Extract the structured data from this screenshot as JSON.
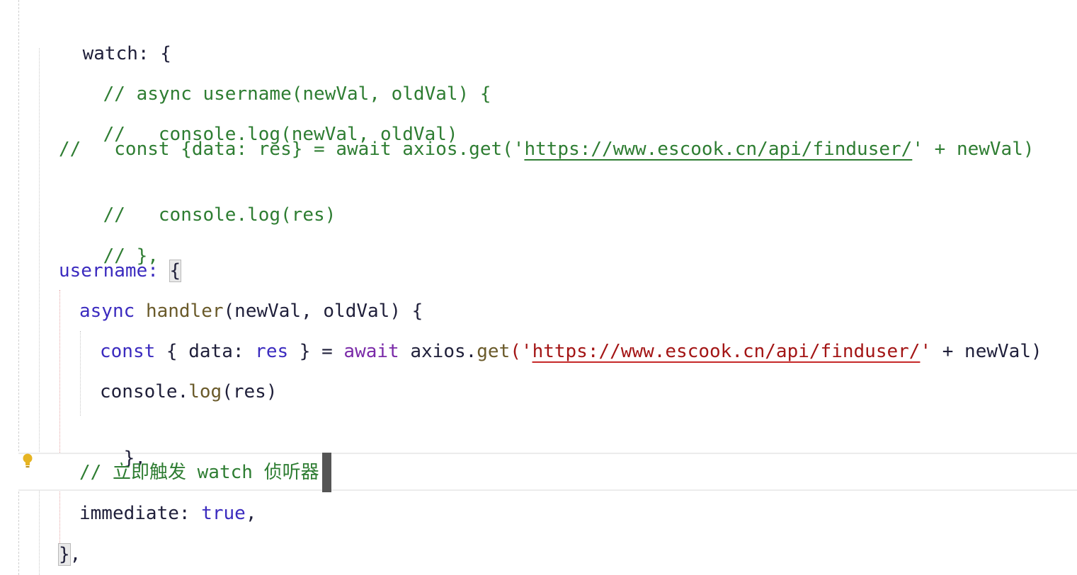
{
  "editor": {
    "lines": [
      {
        "id": "l1",
        "tokens": [
          "watch: {"
        ]
      },
      {
        "id": "l2",
        "tokens": [
          "// async username(newVal, oldVal) {"
        ]
      },
      {
        "id": "l3",
        "tokens": [
          "//   console.log(newVal, oldVal)"
        ]
      },
      {
        "id": "l4",
        "tokens": [
          "//   const {data: res} = await axios.get('",
          "https://www.escook.cn/api/finduser/",
          "' + newVal)"
        ]
      },
      {
        "id": "l5",
        "tokens": [
          "//   console.log(res)"
        ]
      },
      {
        "id": "l6",
        "tokens": [
          "// },"
        ]
      },
      {
        "id": "l7",
        "tokens": [
          "username: ",
          "{"
        ]
      },
      {
        "id": "l8",
        "tokens": [
          "async",
          " ",
          "handler",
          "(newVal, oldVal) {"
        ]
      },
      {
        "id": "l9",
        "tokens": [
          "const",
          " { data: ",
          "res",
          " } = ",
          "await",
          " axios.",
          "get",
          "('",
          "https://www.escook.cn/api/finduser/",
          "'",
          " + newVal)"
        ]
      },
      {
        "id": "l10",
        "tokens": [
          "console.",
          "log",
          "(res)"
        ]
      },
      {
        "id": "l11",
        "tokens": [
          "},"
        ]
      },
      {
        "id": "l12",
        "tokens": [
          "// ",
          "立即触发",
          " watch ",
          "侦听器"
        ]
      },
      {
        "id": "l13",
        "tokens": [
          "immediate: ",
          "true",
          ","
        ]
      },
      {
        "id": "l14",
        "tokens": [
          "}",
          ","
        ]
      }
    ]
  },
  "icons": {
    "gutter": "lightbulb-icon"
  },
  "colors": {
    "comment": "#2e7d32",
    "keyword": "#3b2bbf",
    "await": "#7a2aa8",
    "string": "#a31515",
    "text": "#1f1f3a",
    "bulb": "#e6b422"
  }
}
